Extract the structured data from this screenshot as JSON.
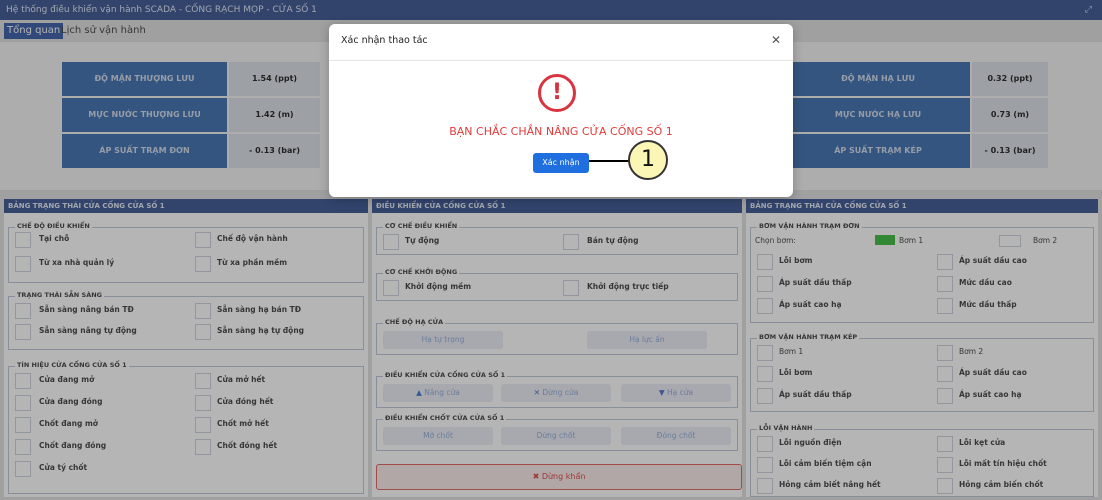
{
  "window": {
    "title": "Hệ thống điều khiển vận hành SCADA - CỐNG RẠCH MỌP - CỬA SỐ 1",
    "maximize_icon": "⤢"
  },
  "tabs": [
    {
      "label": "Tổng quan",
      "active": true
    },
    {
      "label": "Lịch sử vận hành",
      "active": false
    }
  ],
  "metrics_left": [
    {
      "label": "ĐỘ MẶN THƯỢNG LƯU",
      "value": "1.54 (ppt)"
    },
    {
      "label": "MỰC NƯỚC THƯỢNG LƯU",
      "value": "1.42 (m)"
    },
    {
      "label": "ÁP SUẤT TRẠM ĐƠN",
      "value": "- 0.13 (bar)"
    }
  ],
  "metrics_right": [
    {
      "label": "ĐỘ MẶN HẠ LƯU",
      "value": "0.32 (ppt)"
    },
    {
      "label": "MỰC NƯỚC HẠ LƯU",
      "value": "0.73 (m)"
    },
    {
      "label": "ÁP SUẤT TRẠM KÉP",
      "value": "- 0.13 (bar)"
    }
  ],
  "left_panel": {
    "header": "BẢNG TRẠNG THÁI CỬA CỐNG CỬA SỐ 1",
    "mode_group": {
      "title": "CHẾ ĐỘ ĐIỀU KHIỂN",
      "items": [
        "Tại chỗ",
        "Chế độ vận hành",
        "Từ xa nhà quản lý",
        "Từ xa phần mềm"
      ]
    },
    "ready_group": {
      "title": "TRẠNG THÁI SẴN SÀNG",
      "items": [
        "Sẵn sàng nâng bán TĐ",
        "Sẵn sàng hạ bán TĐ",
        "Sẵn sàng nâng tự động",
        "Sẵn sàng hạ tự động"
      ]
    },
    "signal_group": {
      "title": "TÍN HIỆU CỬA CỐNG CỬA SỐ 1",
      "items": [
        "Cửa đang mở",
        "Cửa mở hết",
        "Cửa đang đóng",
        "Cửa đóng hết",
        "Chốt đang mở",
        "Chốt mở hết",
        "Chốt đang đóng",
        "Chốt đóng hết",
        "Cửa tý chốt"
      ]
    }
  },
  "center_panel": {
    "header": "ĐIỀU KHIỂN CỬA CỐNG CỬA SỐ 1",
    "control_mode": {
      "title": "CƠ CHẾ ĐIỀU KHIỂN",
      "items": [
        "Tự động",
        "Bán tự động"
      ]
    },
    "start_mode": {
      "title": "CƠ CHẾ KHỞI ĐỘNG",
      "items": [
        "Khởi động mềm",
        "Khởi động trực tiếp"
      ]
    },
    "lower_mode": {
      "title": "CHẾ ĐỘ HẠ CỬA",
      "buttons": [
        "Hạ tự trọng",
        "Hạ lực ấn"
      ]
    },
    "gate_control": {
      "title": "ĐIỀU KHIỂN CỬA CỐNG CỬA SỐ 1",
      "buttons": [
        {
          "label": "Nâng cửa",
          "icon": "▲"
        },
        {
          "label": "Dừng cửa",
          "icon": "✕"
        },
        {
          "label": "Hạ cửa",
          "icon": "▼"
        }
      ]
    },
    "latch_control": {
      "title": "ĐIỀU KHIỂN CHỐT CỬA CỬA SỐ 1",
      "buttons": [
        "Mở chốt",
        "Dừng chốt",
        "Đóng chốt"
      ]
    },
    "emergency": {
      "label": "Dừng khẩn",
      "icon": "✖"
    }
  },
  "right_panel": {
    "header": "BẢNG TRẠNG THÁI CỬA CỐNG CỬA SỐ 1",
    "single_pump": {
      "title": "BƠM VẬN HÀNH TRẠM ĐƠN",
      "select_label": "Chọn bơm:",
      "pump1": "Bơm 1",
      "pump2": "Bơm 2",
      "pump1_color": "#2fb52f",
      "items": [
        "Lỗi bơm",
        "Áp suất dầu cao",
        "Áp suất dầu thấp",
        "Mức dầu cao",
        "Áp suất cao hạ",
        "Mức dầu thấp"
      ]
    },
    "double_pump": {
      "title": "BƠM VẬN HÀNH TRẠM KÉP",
      "items": [
        "Bơm 1",
        "Bơm 2",
        "Lỗi bơm",
        "Áp suất dầu cao",
        "Áp suất dầu thấp",
        "Áp suất cao hạ"
      ]
    },
    "faults": {
      "title": "LỖI VẬN HÀNH",
      "items": [
        "Lỗi nguồn điện",
        "Lỗi kẹt cửa",
        "Lỗi cảm biến tiệm cận",
        "Lỗi mất tín hiệu chốt",
        "Hỏng cảm biết nâng hết",
        "Hỏng cảm biến chốt"
      ]
    }
  },
  "modal": {
    "title": "Xác nhận thao tác",
    "close_icon": "✕",
    "warning_icon": "!",
    "message": "BẠN CHẮC CHẮN NÂNG CỬA CỐNG SỐ 1",
    "confirm_label": "Xác nhận"
  },
  "callout": {
    "number": "1"
  }
}
